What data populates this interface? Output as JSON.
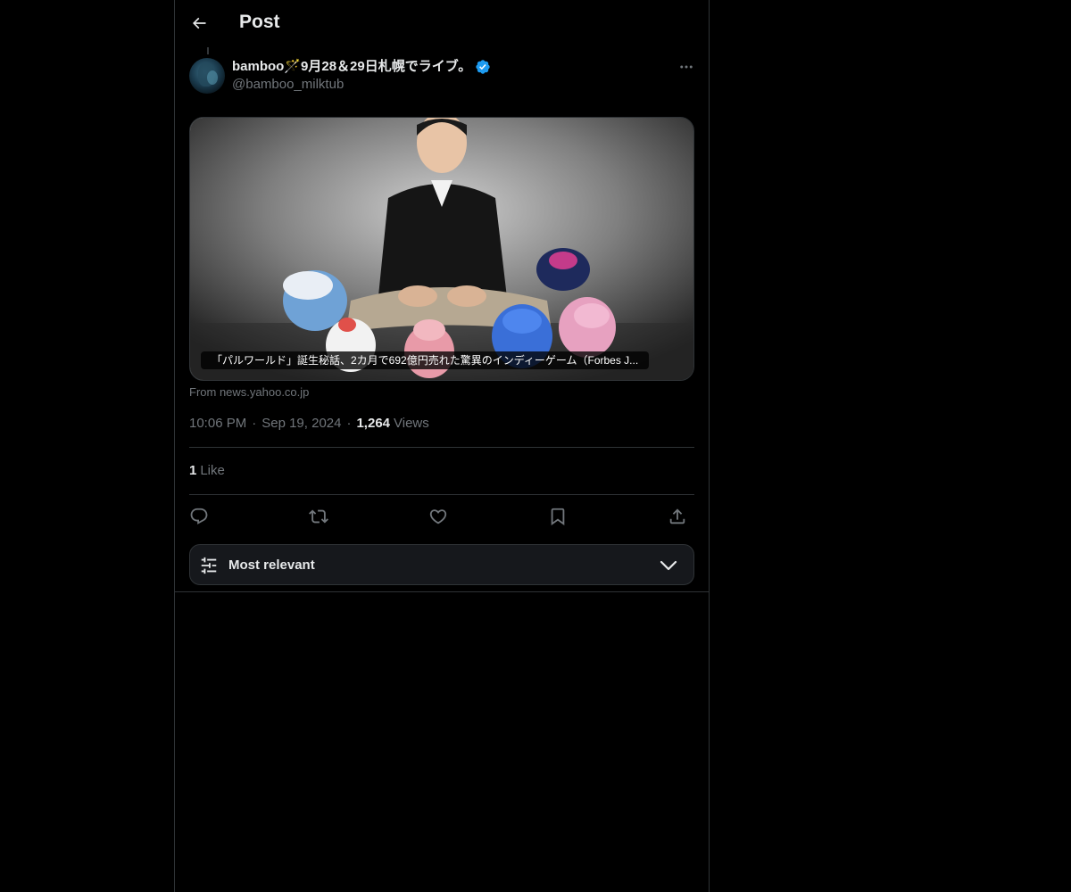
{
  "header": {
    "title": "Post"
  },
  "post": {
    "author": {
      "display_name": "bamboo🪄9月28＆29日札幌でライブ。",
      "handle": "@bamboo_milktub",
      "verified": true
    },
    "card": {
      "caption": "「パルワールド」誕生秘話、2カ月で692億円売れた驚異のインディーゲーム（Forbes J...",
      "source": "From news.yahoo.co.jp"
    },
    "time": "10:06 PM",
    "date": "Sep 19, 2024",
    "views_count": "1,264",
    "views_label": "Views",
    "likes_count": "1",
    "likes_label": "Like"
  },
  "sort": {
    "label": "Most relevant"
  },
  "colors": {
    "background": "#000000",
    "text": "#e7e9ea",
    "muted": "#71767b",
    "border": "#2f3336",
    "verified": "#1d9bf0"
  },
  "icons": {
    "back": "arrow-left-icon",
    "more": "more-horizontal-icon",
    "verified": "verified-badge-icon",
    "reply": "reply-icon",
    "repost": "repost-icon",
    "like": "heart-icon",
    "bookmark": "bookmark-icon",
    "share": "share-icon",
    "sort": "sliders-icon",
    "chevron": "chevron-down-icon"
  }
}
